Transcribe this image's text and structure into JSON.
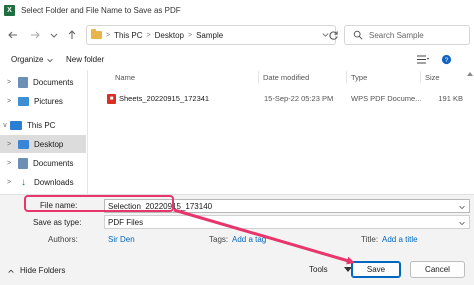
{
  "window": {
    "title": "Select Folder and File Name to Save as PDF",
    "app_icon": "X"
  },
  "nav": {
    "back_icon": "arrow-left",
    "forward_icon": "arrow-right",
    "recent_icon": "chevron-down",
    "up_icon": "arrow-up",
    "breadcrumb": [
      "This PC",
      "Desktop",
      "Sample"
    ],
    "sep": ">",
    "search_placeholder": "Search Sample"
  },
  "toolbar": {
    "organize_label": "Organize",
    "new_folder_label": "New folder"
  },
  "sidebar": {
    "items": [
      {
        "label": "Documents",
        "chevron": ">"
      },
      {
        "label": "Pictures",
        "chevron": ">"
      },
      {
        "label": "This PC",
        "chevron": "v"
      },
      {
        "label": "Desktop",
        "chevron": ">"
      },
      {
        "label": "Documents",
        "chevron": ">"
      },
      {
        "label": "Downloads",
        "chevron": ">"
      }
    ]
  },
  "columns": {
    "name": "Name",
    "date": "Date modified",
    "type": "Type",
    "size": "Size"
  },
  "files": [
    {
      "name": "Sheets_20220915_172341",
      "date": "15-Sep-22 05:23 PM",
      "type": "WPS PDF Docume...",
      "size": "191 KB"
    }
  ],
  "form": {
    "file_name_label": "File name:",
    "file_name_value": "Selection_20220915_173140",
    "save_type_label": "Save as type:",
    "save_type_value": "PDF Files",
    "authors_label": "Authors:",
    "authors_value": "Sir Den",
    "tags_label": "Tags:",
    "tags_value": "Add a tag",
    "title_label": "Title:",
    "title_value": "Add a title"
  },
  "footer": {
    "hide_folders_label": "Hide Folders",
    "tools_label": "Tools",
    "save_label": "Save",
    "cancel_label": "Cancel"
  },
  "colors": {
    "highlight": "#e8366d",
    "link": "#0067c0",
    "selected": "#dcdcdc"
  }
}
